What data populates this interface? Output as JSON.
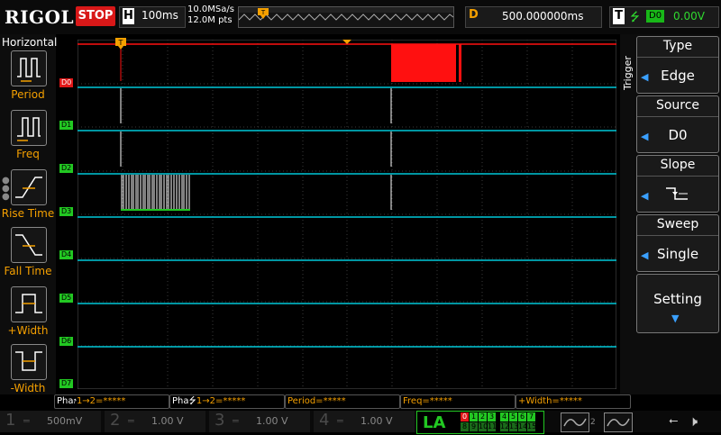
{
  "top_bar": {
    "logo": "RIGOL",
    "run_state": "STOP",
    "horizontal_letter": "H",
    "timebase": "100ms",
    "sample_rate": "10.0MSa/s",
    "memory_depth": "12.0M pts",
    "delay_letter": "D",
    "delay_value": "500.000000ms",
    "trigger_letter": "T",
    "trigger_source_badge": "D0",
    "trigger_level": "0.00V"
  },
  "left_panel": {
    "title": "Horizontal",
    "items": [
      {
        "label": "Period",
        "icon": "period-icon"
      },
      {
        "label": "Freq",
        "icon": "frequency-icon"
      },
      {
        "label": "Rise Time",
        "icon": "rise-time-icon"
      },
      {
        "label": "Fall Time",
        "icon": "fall-time-icon"
      },
      {
        "label": "+Width",
        "icon": "positive-width-icon"
      },
      {
        "label": "-Width",
        "icon": "negative-width-icon"
      }
    ]
  },
  "channels": [
    "D0",
    "D1",
    "D2",
    "D3",
    "D4",
    "D5",
    "D6",
    "D7"
  ],
  "right_menu": {
    "tab": "Trigger",
    "type_title": "Type",
    "type_value": "Edge",
    "source_title": "Source",
    "source_value": "D0",
    "slope_title": "Slope",
    "sweep_title": "Sweep",
    "sweep_value": "Single",
    "setting_label": "Setting"
  },
  "measurements": [
    {
      "label": "Pha",
      "value": "1→2=*****",
      "edge": "rise"
    },
    {
      "label": "Pha",
      "value": "1→2=*****",
      "edge": "fall"
    },
    {
      "label": "Period=",
      "value": "*****"
    },
    {
      "label": "Freq=",
      "value": "*****"
    },
    {
      "label": "+Width=",
      "value": "*****"
    }
  ],
  "bottom_bar": {
    "ch1_num": "1",
    "ch1_scale": "500mV",
    "ch2_num": "2",
    "ch2_scale": "1.00 V",
    "ch3_num": "3",
    "ch3_scale": "1.00 V",
    "ch4_num": "4",
    "ch4_scale": "1.00 V",
    "la_label": "LA",
    "la_top_digits": [
      "0",
      "1",
      "2",
      "3",
      "4",
      "5",
      "6",
      "7"
    ],
    "la_bottom_digits": [
      "8",
      "9",
      "10",
      "11",
      "12",
      "13",
      "14",
      "15"
    ],
    "math_ref_num": "2"
  },
  "colors": {
    "trace": "#00c8d8",
    "pulse": "#ff1010",
    "accent": "#f5a000",
    "digital_label": "#22c822",
    "grid": "#3a3a3a"
  }
}
